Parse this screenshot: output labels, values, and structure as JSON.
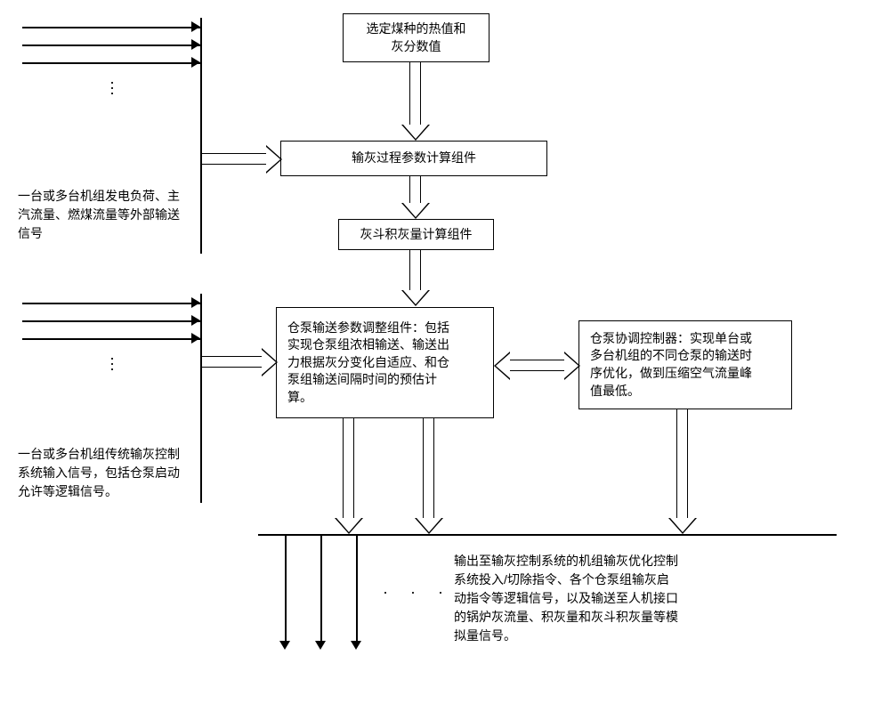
{
  "boxes": {
    "coal_input": "选定煤种的热值和\n灰分数值",
    "process_calc": "输灰过程参数计算组件",
    "hopper_calc": "灰斗积灰量计算组件",
    "param_adjust": "仓泵输送参数调整组件：包括\n实现仓泵组浓相输送、输送出\n力根据灰分变化自适应、和仓\n泵组输送间隔时间的预估计\n算。",
    "coordinator": "仓泵协调控制器：实现单台或\n多台机组的不同仓泵的输送时\n序优化，做到压缩空气流量峰\n值最低。"
  },
  "labels": {
    "input_top": "一台或多台机组发电负荷、主\n汽流量、燃煤流量等外部输送\n信号",
    "input_bottom": "一台或多台机组传统输灰控制\n系统输入信号，包括仓泵启动\n允许等逻辑信号。",
    "output": "输出至输灰控制系统的机组输灰优化控制\n系统投入/切除指令、各个仓泵组输灰启\n动指令等逻辑信号，以及输送至人机接口\n的锅炉灰流量、积灰量和灰斗积灰量等模\n拟量信号。"
  }
}
